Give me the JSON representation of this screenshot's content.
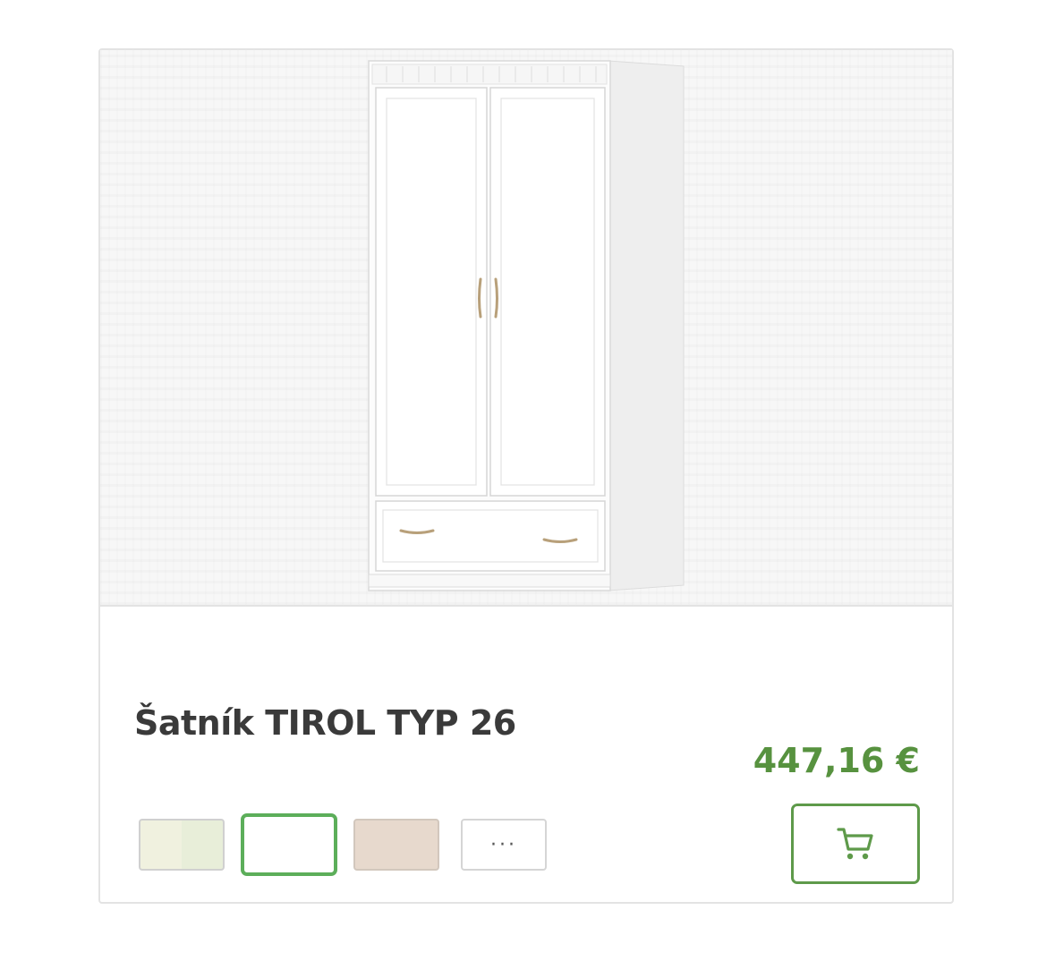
{
  "product": {
    "title": "Šatník TIROL TYP 26",
    "price": "447,16 €",
    "image_icon": "wardrobe-image",
    "swatches": [
      {
        "color": "#f0f1df",
        "selected": false
      },
      {
        "color": "#ffffff",
        "selected": true
      },
      {
        "color": "#e7d9cd",
        "selected": false
      }
    ],
    "more_swatches_label": "···",
    "cart_icon": "shopping-cart-icon"
  },
  "colors": {
    "price": "#57923f",
    "accent": "#5cae5a",
    "title": "#3a3a3a"
  }
}
